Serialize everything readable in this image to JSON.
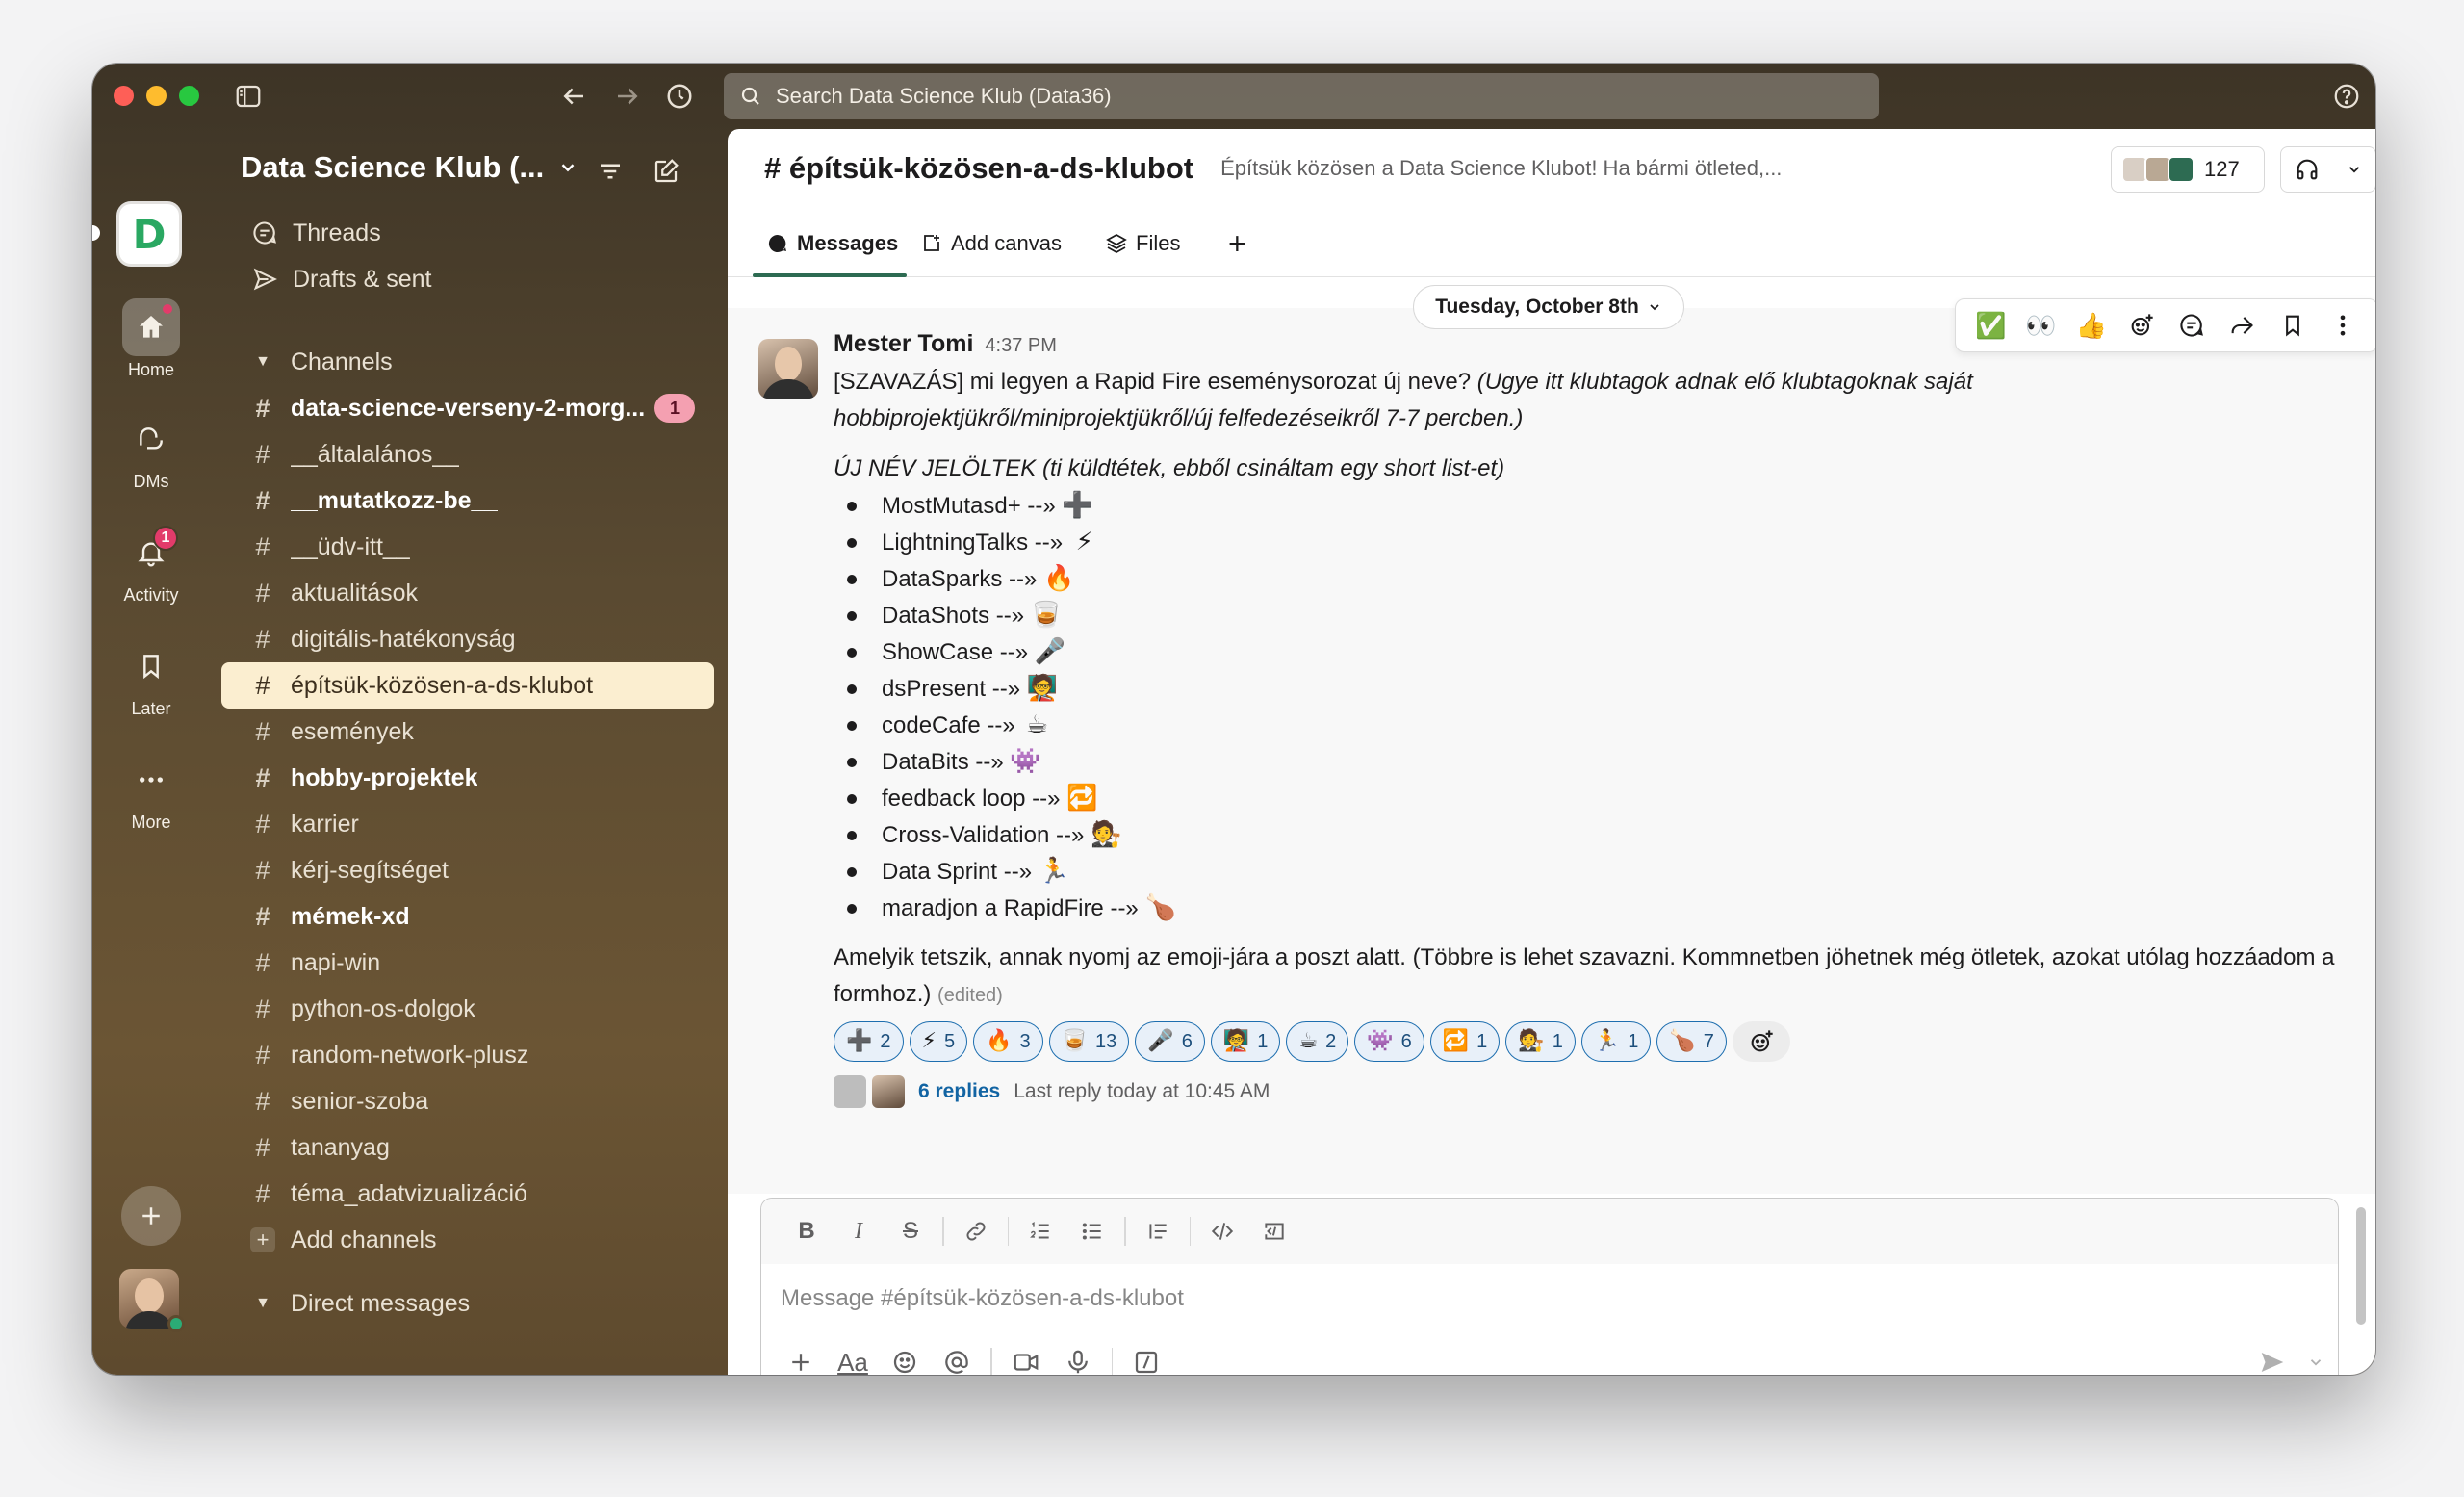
{
  "search": {
    "placeholder": "Search Data Science Klub (Data36)"
  },
  "workspace": {
    "name": "Data Science Klub (..."
  },
  "rail": {
    "home": "Home",
    "dms": "DMs",
    "activity": "Activity",
    "activity_badge": "1",
    "later": "Later",
    "more": "More"
  },
  "sidebar": {
    "threads": "Threads",
    "drafts": "Drafts & sent",
    "channels_header": "Channels",
    "channels": [
      {
        "name": "data-science-verseny-2-morg...",
        "badge": "1"
      },
      {
        "name": "__általalános__"
      },
      {
        "name": "__mutatkozz-be__"
      },
      {
        "name": "__üdv-itt__"
      },
      {
        "name": "aktualitások"
      },
      {
        "name": "digitális-hatékonyság"
      },
      {
        "name": "építsük-közösen-a-ds-klubot"
      },
      {
        "name": "események"
      },
      {
        "name": "hobby-projektek"
      },
      {
        "name": "karrier"
      },
      {
        "name": "kérj-segítséget"
      },
      {
        "name": "mémek-xd"
      },
      {
        "name": "napi-win"
      },
      {
        "name": "python-os-dolgok"
      },
      {
        "name": "random-network-plusz"
      },
      {
        "name": "senior-szoba"
      },
      {
        "name": "tananyag"
      },
      {
        "name": "téma_adatvizualizáció"
      }
    ],
    "add_channels": "Add channels",
    "dm_header": "Direct messages"
  },
  "channel": {
    "title": "# építsük-közösen-a-ds-klubot",
    "description": "Építsük közösen a Data Science Klubot! Ha bármi ötleted,...",
    "member_count": "127"
  },
  "tabs": {
    "messages": "Messages",
    "canvas": "Add canvas",
    "files": "Files",
    "add": "+"
  },
  "date_divider": "Tuesday, October 8th",
  "hover_emojis": [
    "✅",
    "👀",
    "👍"
  ],
  "message": {
    "author": "Mester Tomi",
    "time": "4:37 PM",
    "intro": "[SZAVAZÁS] mi legyen a Rapid Fire eseménysorozat új neve?",
    "intro_italic": "(Ugye itt klubtagok adnak elő klubtagoknak saját hobbiprojektjükről/miniprojektjükről/új felfedezéseikről 7-7 percben.)",
    "candidates_heading": "ÚJ NÉV JELÖLTEK (ti küldtétek, ebből csináltam egy short list-et)",
    "candidates": [
      {
        "text": "MostMutasd+ --»",
        "emoji": "➕"
      },
      {
        "text": "LightningTalks --»",
        "emoji": "⚡"
      },
      {
        "text": "DataSparks --»",
        "emoji": "🔥"
      },
      {
        "text": "DataShots --»",
        "emoji": "🥃"
      },
      {
        "text": "ShowCase --»",
        "emoji": "🎤"
      },
      {
        "text": "dsPresent --»",
        "emoji": "🧑‍🏫"
      },
      {
        "text": "codeCafe --»",
        "emoji": "☕"
      },
      {
        "text": "DataBits --»",
        "emoji": "👾"
      },
      {
        "text": "feedback loop --»",
        "emoji": "🔁"
      },
      {
        "text": "Cross-Validation --»",
        "emoji": "🧑‍⚖️"
      },
      {
        "text": "Data Sprint --»",
        "emoji": "🏃"
      },
      {
        "text": "maradjon a RapidFire --»",
        "emoji": "🍗"
      }
    ],
    "closing": "Amelyik tetszik, annak nyomj az emoji-jára a poszt alatt. (Többre is lehet szavazni. Kommnetben jöhetnek még ötletek, azokat utólag hozzáadom a formhoz.)",
    "edited": "(edited)",
    "reactions": [
      {
        "emoji": "➕",
        "count": "2"
      },
      {
        "emoji": "⚡",
        "count": "5"
      },
      {
        "emoji": "🔥",
        "count": "3"
      },
      {
        "emoji": "🥃",
        "count": "13"
      },
      {
        "emoji": "🎤",
        "count": "6"
      },
      {
        "emoji": "🧑‍🏫",
        "count": "1"
      },
      {
        "emoji": "☕",
        "count": "2"
      },
      {
        "emoji": "👾",
        "count": "6"
      },
      {
        "emoji": "🔁",
        "count": "1"
      },
      {
        "emoji": "🧑‍⚖️",
        "count": "1"
      },
      {
        "emoji": "🏃",
        "count": "1"
      },
      {
        "emoji": "🍗",
        "count": "7"
      }
    ],
    "replies_link": "6 replies",
    "last_reply": "Last reply today at 10:45 AM"
  },
  "composer": {
    "placeholder": "Message #építsük-közösen-a-ds-klubot"
  }
}
